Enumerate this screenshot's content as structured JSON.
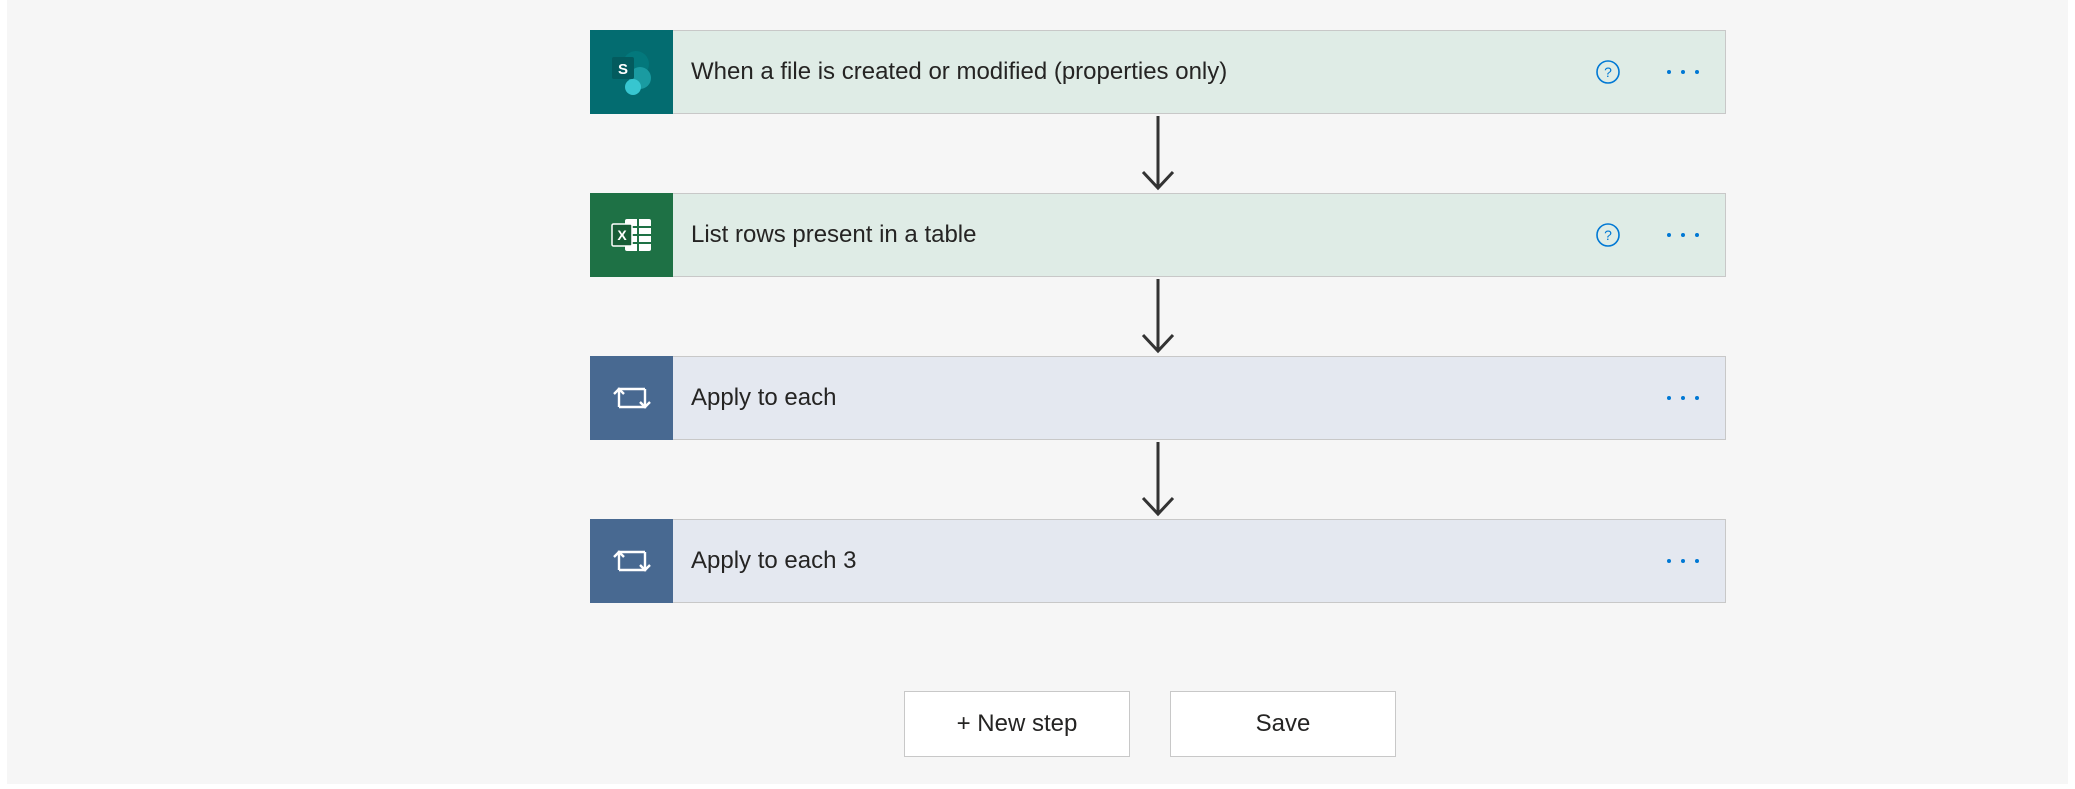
{
  "flow": {
    "steps": [
      {
        "title": "When a file is created or modified (properties only)",
        "icon": "sharepoint-icon",
        "icon_bg": "#036c70",
        "card_bg": "#dfece6",
        "has_help": true
      },
      {
        "title": "List rows present in a table",
        "icon": "excel-icon",
        "icon_bg": "#1e7145",
        "card_bg": "#dfece6",
        "has_help": true
      },
      {
        "title": "Apply to each",
        "icon": "loop-icon",
        "icon_bg": "#486991",
        "card_bg": "#e4e8f0",
        "has_help": false
      },
      {
        "title": "Apply to each 3",
        "icon": "loop-icon",
        "icon_bg": "#486991",
        "card_bg": "#e4e8f0",
        "has_help": false
      }
    ]
  },
  "actions": {
    "new_step_label": "+ New step",
    "save_label": "Save"
  },
  "colors": {
    "accent": "#0078d4",
    "connector": "#333333",
    "canvas": "#f6f6f6"
  }
}
